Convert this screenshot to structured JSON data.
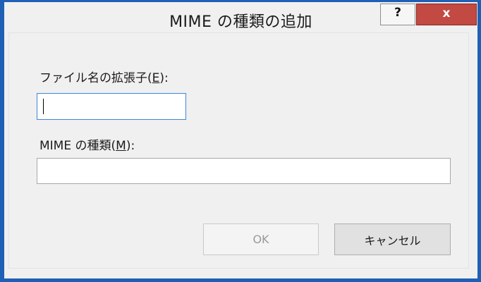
{
  "window": {
    "title": "MIME の種類の追加",
    "help_glyph": "?",
    "close_glyph": "x",
    "close_color": "#c24a43",
    "frame_color": "#1f5fb6"
  },
  "form": {
    "extension_label_prefix": "ファイル名の拡張子(",
    "extension_label_access": "E",
    "extension_label_suffix": "):",
    "extension_value": "",
    "mime_label_prefix": "MIME の種類(",
    "mime_label_access": "M",
    "mime_label_suffix": "):",
    "mime_value": ""
  },
  "buttons": {
    "ok_label": "OK",
    "cancel_label": "キャンセル"
  }
}
